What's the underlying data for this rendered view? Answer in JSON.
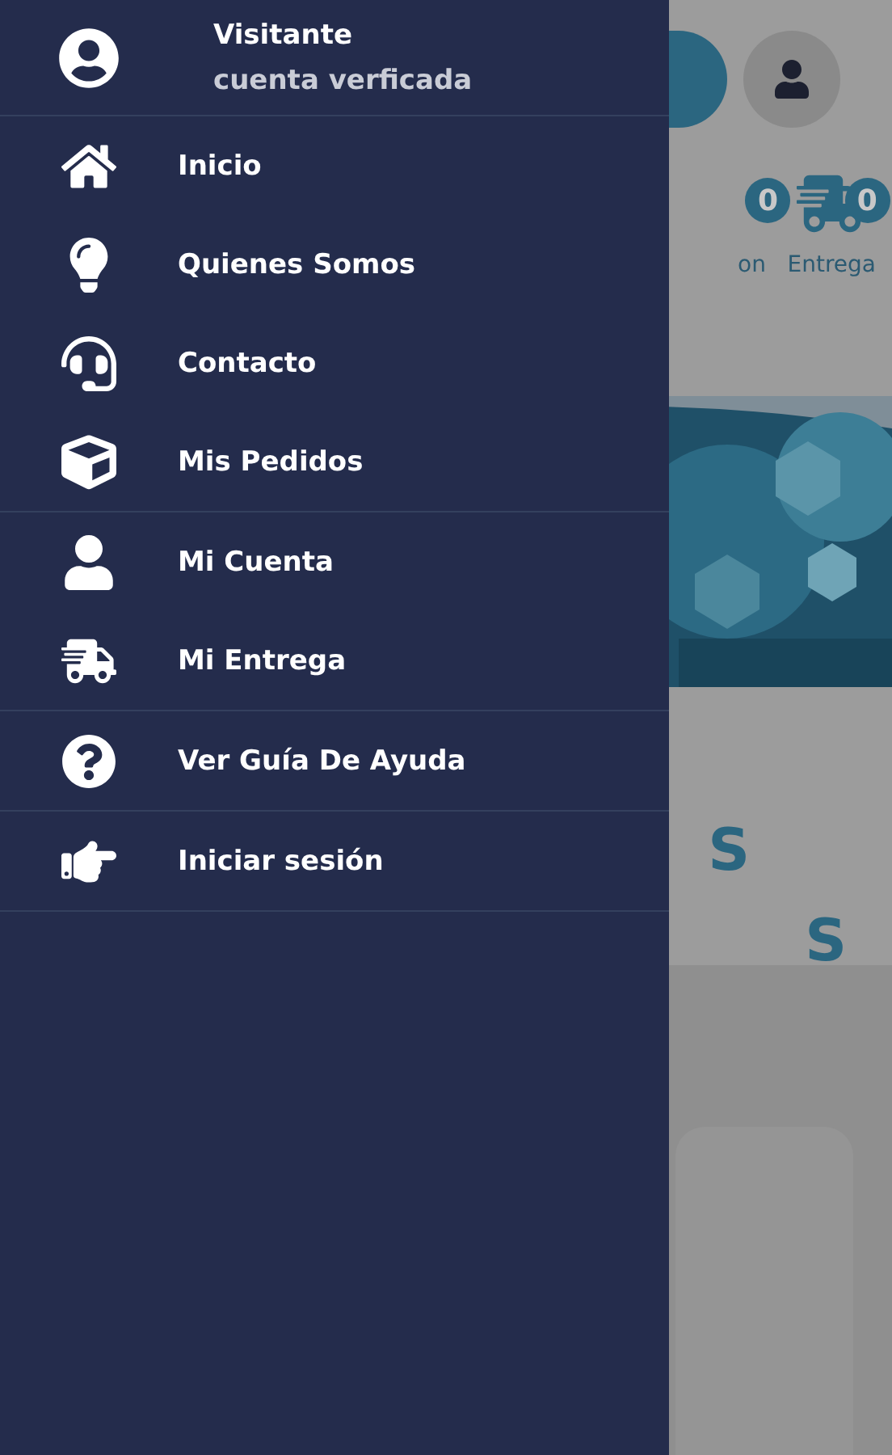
{
  "drawer": {
    "header": {
      "name": "Visitante",
      "status": "cuenta verficada"
    },
    "sections": [
      {
        "items": [
          {
            "label": "Inicio",
            "kind": "home"
          },
          {
            "label": "Quienes Somos",
            "kind": "about"
          },
          {
            "label": "Contacto",
            "kind": "contact"
          },
          {
            "label": "Mis Pedidos",
            "kind": "orders"
          }
        ]
      },
      {
        "items": [
          {
            "label": "Mi Cuenta",
            "kind": "account"
          },
          {
            "label": "Mi Entrega",
            "kind": "delivery"
          }
        ]
      },
      {
        "items": [
          {
            "label": "Ver Guía De Ayuda",
            "kind": "help"
          }
        ]
      },
      {
        "items": [
          {
            "label": "Iniciar sesión",
            "kind": "login"
          }
        ]
      }
    ]
  },
  "background_page": {
    "badges": [
      {
        "count": "0",
        "label": "on",
        "kind": "partial"
      },
      {
        "count": "0",
        "label": "Entrega",
        "kind": "delivery"
      }
    ],
    "heading_lines": [
      "S",
      "S"
    ]
  }
}
